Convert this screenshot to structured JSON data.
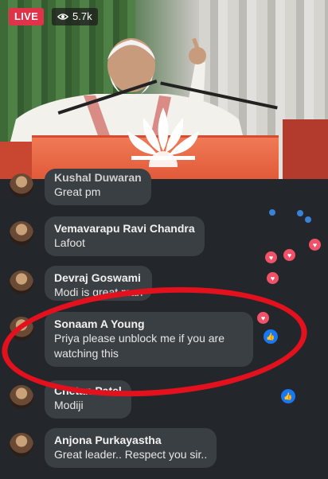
{
  "stream": {
    "live_label": "LIVE",
    "viewers": "5.7k",
    "accent": "#e0334a"
  },
  "comments": [
    {
      "name": "Kushal Duwaran",
      "text": "Great pm"
    },
    {
      "name": "Vemavarapu Ravi Chandra",
      "text": "Lafoot"
    },
    {
      "name": "Devraj Goswami",
      "text": "Modi is great man"
    },
    {
      "name": "Sonaam A Young",
      "text": "Priya please unblock me if you are watching this"
    },
    {
      "name": "Chetan Patel",
      "text": "Modiji"
    },
    {
      "name": "Anjona Purkayastha",
      "text": "Great leader.. Respect you sir.."
    }
  ],
  "colors": {
    "highlight_ring": "#e3101e",
    "heart": "#f25268",
    "like": "#1877f2"
  }
}
